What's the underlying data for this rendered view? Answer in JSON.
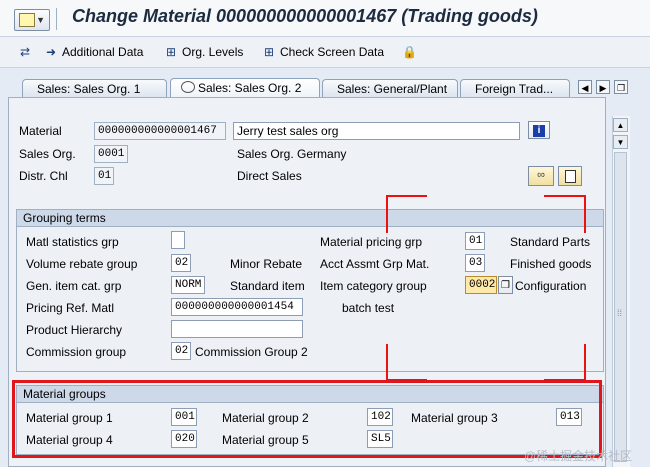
{
  "window": {
    "title": "Change Material 000000000000001467 (Trading goods)"
  },
  "toolbar": {
    "additional_data": "Additional Data",
    "org_levels": "Org. Levels",
    "check_screen_data": "Check Screen Data"
  },
  "tabs": [
    {
      "label": "Sales: Sales Org. 1"
    },
    {
      "label": "Sales: Sales Org. 2"
    },
    {
      "label": "Sales: General/Plant"
    },
    {
      "label": "Foreign Trad..."
    }
  ],
  "header": {
    "material_label": "Material",
    "material_value": "000000000000001467",
    "material_desc": "Jerry test sales org",
    "sales_org_label": "Sales Org.",
    "sales_org_value": "0001",
    "sales_org_desc": "Sales Org. Germany",
    "distr_chl_label": "Distr. Chl",
    "distr_chl_value": "01",
    "distr_chl_desc": "Direct Sales"
  },
  "grouping": {
    "title": "Grouping terms",
    "matl_stat_grp_label": "Matl statistics grp",
    "matl_stat_grp_value": "",
    "vol_rebate_label": "Volume rebate group",
    "vol_rebate_value": "02",
    "vol_rebate_desc": "Minor Rebate",
    "gen_item_cat_label": "Gen. item cat. grp",
    "gen_item_cat_value": "NORM",
    "gen_item_cat_desc": "Standard item",
    "pricing_ref_label": "Pricing Ref. Matl",
    "pricing_ref_value": "000000000000001454",
    "prod_hier_label": "Product Hierarchy",
    "prod_hier_value": "",
    "comm_group_label": "Commission group",
    "comm_group_value": "02",
    "comm_group_desc": "Commission Group 2",
    "mat_pricing_grp_label": "Material pricing grp",
    "mat_pricing_grp_value": "01",
    "mat_pricing_grp_desc": "Standard Parts",
    "acct_assmt_label": "Acct Assmt Grp Mat.",
    "acct_assmt_value": "03",
    "acct_assmt_desc": "Finished goods",
    "item_cat_grp_label": "Item category group",
    "item_cat_grp_value": "0002",
    "item_cat_grp_desc": "Configuration",
    "item_cat_grp_desc2": "batch test"
  },
  "matgroups": {
    "title": "Material groups",
    "g1_label": "Material group 1",
    "g1_value": "001",
    "g2_label": "Material group 2",
    "g2_value": "102",
    "g3_label": "Material group 3",
    "g3_value": "013",
    "g4_label": "Material group 4",
    "g4_value": "020",
    "g5_label": "Material group 5",
    "g5_value": "SL5"
  },
  "watermark": "@稀土掘金技术社区",
  "colors": {
    "highlight_box": "#e0161c",
    "active_field": "#ffe9a8",
    "group_header": "#cdd8e8"
  }
}
